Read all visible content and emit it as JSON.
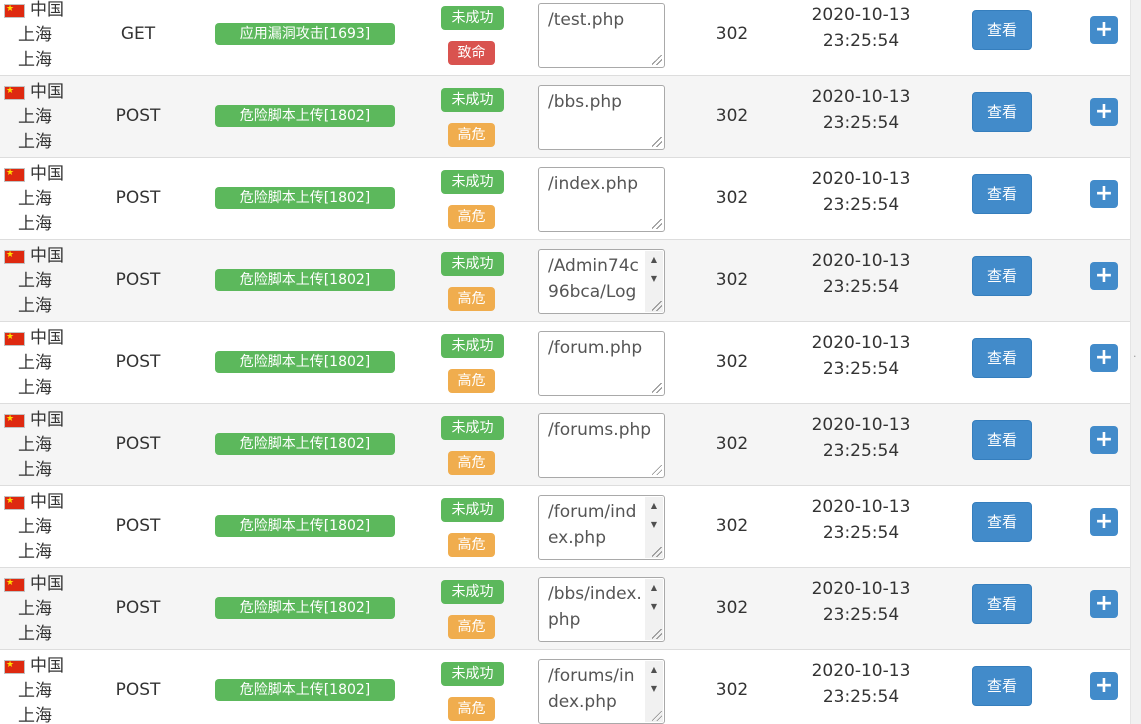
{
  "table": {
    "view_label": "查看",
    "rows": [
      {
        "country": "中国",
        "province": "上海",
        "city": "上海",
        "method": "GET",
        "rule": "应用漏洞攻击[1693]",
        "status": "未成功",
        "level": "致命",
        "level_type": "fatal",
        "url": "/test.php",
        "url_scroll": false,
        "code": "302",
        "date": "2020-10-13",
        "time": "23:25:54"
      },
      {
        "country": "中国",
        "province": "上海",
        "city": "上海",
        "method": "POST",
        "rule": "危险脚本上传[1802]",
        "status": "未成功",
        "level": "高危",
        "level_type": "high",
        "url": "/bbs.php",
        "url_scroll": false,
        "code": "302",
        "date": "2020-10-13",
        "time": "23:25:54"
      },
      {
        "country": "中国",
        "province": "上海",
        "city": "上海",
        "method": "POST",
        "rule": "危险脚本上传[1802]",
        "status": "未成功",
        "level": "高危",
        "level_type": "high",
        "url": "/index.php",
        "url_scroll": false,
        "code": "302",
        "date": "2020-10-13",
        "time": "23:25:54"
      },
      {
        "country": "中国",
        "province": "上海",
        "city": "上海",
        "method": "POST",
        "rule": "危险脚本上传[1802]",
        "status": "未成功",
        "level": "高危",
        "level_type": "high",
        "url": "/Admin74c96bca/Log",
        "url_scroll": true,
        "code": "302",
        "date": "2020-10-13",
        "time": "23:25:54"
      },
      {
        "country": "中国",
        "province": "上海",
        "city": "上海",
        "method": "POST",
        "rule": "危险脚本上传[1802]",
        "status": "未成功",
        "level": "高危",
        "level_type": "high",
        "url": "/forum.php",
        "url_scroll": false,
        "code": "302",
        "date": "2020-10-13",
        "time": "23:25:54"
      },
      {
        "country": "中国",
        "province": "上海",
        "city": "上海",
        "method": "POST",
        "rule": "危险脚本上传[1802]",
        "status": "未成功",
        "level": "高危",
        "level_type": "high",
        "url": "/forums.php",
        "url_scroll": false,
        "code": "302",
        "date": "2020-10-13",
        "time": "23:25:54"
      },
      {
        "country": "中国",
        "province": "上海",
        "city": "上海",
        "method": "POST",
        "rule": "危险脚本上传[1802]",
        "status": "未成功",
        "level": "高危",
        "level_type": "high",
        "url": "/forum/index.php",
        "url_scroll": true,
        "code": "302",
        "date": "2020-10-13",
        "time": "23:25:54"
      },
      {
        "country": "中国",
        "province": "上海",
        "city": "上海",
        "method": "POST",
        "rule": "危险脚本上传[1802]",
        "status": "未成功",
        "level": "高危",
        "level_type": "high",
        "url": "/bbs/index.php",
        "url_scroll": true,
        "code": "302",
        "date": "2020-10-13",
        "time": "23:25:54"
      },
      {
        "country": "中国",
        "province": "上海",
        "city": "上海",
        "method": "POST",
        "rule": "危险脚本上传[1802]",
        "status": "未成功",
        "level": "高危",
        "level_type": "high",
        "url": "/forums/index.php",
        "url_scroll": true,
        "code": "302",
        "date": "2020-10-13",
        "time": "23:25:54"
      }
    ]
  },
  "icons": {
    "flag": "china-flag-icon",
    "add": "plus-icon",
    "scroll_up": "arrow-up-icon",
    "scroll_down": "arrow-down-icon",
    "resize": "resize-grip-icon"
  },
  "colors": {
    "success_green": "#5cb85c",
    "fatal_red": "#d9534f",
    "high_orange": "#f0ad4e",
    "primary_blue": "#428bca"
  }
}
